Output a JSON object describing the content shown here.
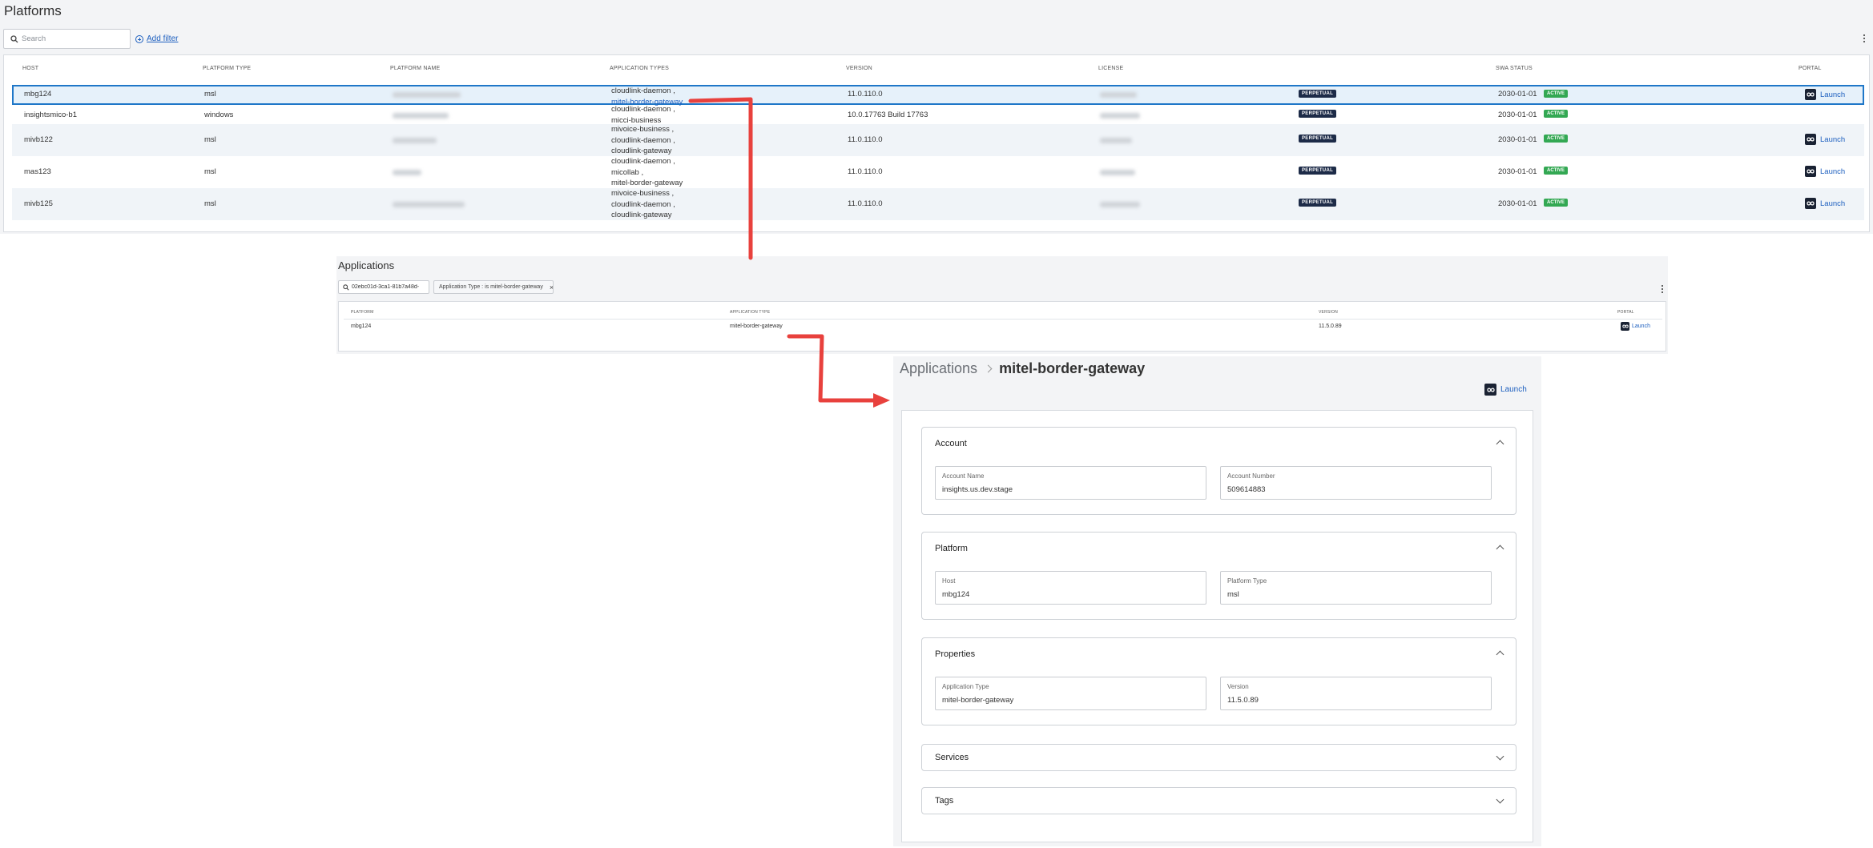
{
  "platforms": {
    "title": "Platforms",
    "search_placeholder": "Search",
    "add_filter_label": "Add filter",
    "columns": [
      "HOST",
      "PLATFORM TYPE",
      "PLATFORM NAME",
      "APPLICATION TYPES",
      "VERSION",
      "LICENSE",
      "SWA STATUS",
      "PORTAL"
    ],
    "rows": [
      {
        "host": "mbg124",
        "platform_type": "msl",
        "apps": [
          "cloudlink-daemon ,",
          "mitel-border-gateway"
        ],
        "version": "11.0.110.0",
        "license_badge": "PERPETUAL",
        "swa_date": "2030-01-01",
        "swa_badge": "ACTIVE",
        "portal": "Launch"
      },
      {
        "host": "insightsmico-b1",
        "platform_type": "windows",
        "apps": [
          "cloudlink-daemon ,",
          "micci-business"
        ],
        "version": "10.0.17763 Build 17763",
        "license_badge": "PERPETUAL",
        "swa_date": "2030-01-01",
        "swa_badge": "ACTIVE",
        "portal": ""
      },
      {
        "host": "mivb122",
        "platform_type": "msl",
        "apps": [
          "mivoice-business ,",
          "cloudlink-daemon ,",
          "cloudlink-gateway"
        ],
        "version": "11.0.110.0",
        "license_badge": "PERPETUAL",
        "swa_date": "2030-01-01",
        "swa_badge": "ACTIVE",
        "portal": "Launch"
      },
      {
        "host": "mas123",
        "platform_type": "msl",
        "apps": [
          "cloudlink-daemon ,",
          "micollab ,",
          "mitel-border-gateway"
        ],
        "version": "11.0.110.0",
        "license_badge": "PERPETUAL",
        "swa_date": "2030-01-01",
        "swa_badge": "ACTIVE",
        "portal": "Launch"
      },
      {
        "host": "mivb125",
        "platform_type": "msl",
        "apps": [
          "mivoice-business ,",
          "cloudlink-daemon ,",
          "cloudlink-gateway"
        ],
        "version": "11.0.110.0",
        "license_badge": "PERPETUAL",
        "swa_date": "2030-01-01",
        "swa_badge": "ACTIVE",
        "portal": "Launch"
      }
    ]
  },
  "applications": {
    "title": "Applications",
    "search_value": "02ebc01d-3ca1-81b7a48d-",
    "filter_chip": "Application Type : is mitel-border-gateway",
    "columns": [
      "PLATFORM",
      "APPLICATION TYPE",
      "VERSION",
      "PORTAL"
    ],
    "row": {
      "platform": "mbg124",
      "application_type": "mitel-border-gateway",
      "version": "11.5.0.89",
      "portal": "Launch"
    }
  },
  "details": {
    "breadcrumb_parent": "Applications",
    "breadcrumb_current": "mitel-border-gateway",
    "launch_label": "Launch",
    "sections": {
      "account": {
        "title": "Account",
        "fields": [
          {
            "label": "Account Name",
            "value": "insights.us.dev.stage"
          },
          {
            "label": "Account Number",
            "value": "509614883"
          }
        ]
      },
      "platform": {
        "title": "Platform",
        "fields": [
          {
            "label": "Host",
            "value": "mbg124"
          },
          {
            "label": "Platform Type",
            "value": "msl"
          }
        ]
      },
      "properties": {
        "title": "Properties",
        "fields": [
          {
            "label": "Application Type",
            "value": "mitel-border-gateway"
          },
          {
            "label": "Version",
            "value": "11.5.0.89"
          }
        ]
      },
      "services": {
        "title": "Services"
      },
      "tags": {
        "title": "Tags"
      }
    }
  },
  "colors": {
    "accent": "#1d5fbf",
    "selected_border": "#1f77c8",
    "badge_dark": "#1d2b48",
    "badge_active": "#33a853",
    "annotation_arrow": "#e8413d"
  }
}
